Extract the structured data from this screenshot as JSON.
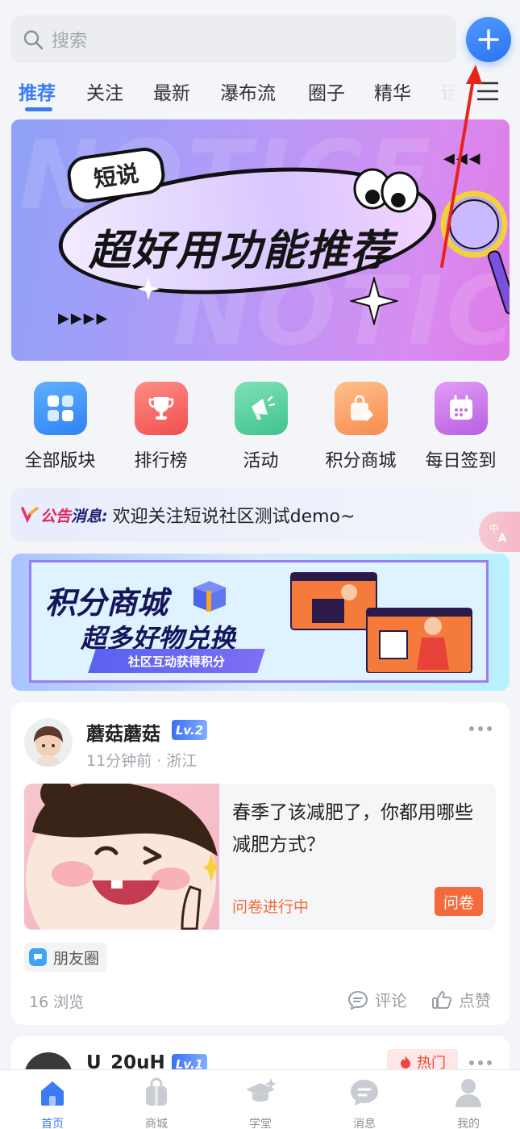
{
  "search": {
    "placeholder": "搜索"
  },
  "tabs": [
    {
      "label": "推荐",
      "active": true
    },
    {
      "label": "关注"
    },
    {
      "label": "最新"
    },
    {
      "label": "瀑布流"
    },
    {
      "label": "圈子"
    },
    {
      "label": "精华"
    },
    {
      "label": "话"
    }
  ],
  "banner": {
    "bubble": "短说",
    "headline": "超好用功能推荐",
    "watermark": "NOTICE"
  },
  "quick_nav": [
    {
      "label": "全部版块",
      "icon": "grid-icon",
      "color": "#3d8ef8"
    },
    {
      "label": "排行榜",
      "icon": "trophy-icon",
      "color": "#f6615e"
    },
    {
      "label": "活动",
      "icon": "megaphone-icon",
      "color": "#45c993"
    },
    {
      "label": "积分商城",
      "icon": "shopping-bag-icon",
      "color": "#f79a59"
    },
    {
      "label": "每日签到",
      "icon": "calendar-icon",
      "color": "#c46ee8"
    }
  ],
  "notice": {
    "tag_prefix": "公告",
    "tag_suffix": "消息:",
    "message": "欢迎关注短说社区测试demo~"
  },
  "mall_banner": {
    "line1": "积分商城",
    "line2": "超多好物兑换",
    "ribbon": "社区互动获得积分"
  },
  "post": {
    "username": "蘑菇蘑菇",
    "level": "Lv.2",
    "meta": "11分钟前 · 浙江",
    "title": "春季了该减肥了，你都用哪些减肥方式？",
    "survey_status": "问卷进行中",
    "survey_badge": "问卷",
    "topic": "朋友圈",
    "views": "16 浏览",
    "comment": "评论",
    "like": "点赞"
  },
  "post2": {
    "username": "U_20uH",
    "level": "Lv.1",
    "badge": "热门"
  },
  "tabbar": [
    {
      "label": "首页",
      "icon": "home-icon",
      "active": true
    },
    {
      "label": "商城",
      "icon": "shop-icon"
    },
    {
      "label": "学堂",
      "icon": "graduation-cap-icon"
    },
    {
      "label": "消息",
      "icon": "chat-icon"
    },
    {
      "label": "我的",
      "icon": "user-icon"
    }
  ],
  "colors": {
    "accent": "#3c7bf6",
    "survey": "#f56a3a",
    "annotation": "#e8231a"
  }
}
